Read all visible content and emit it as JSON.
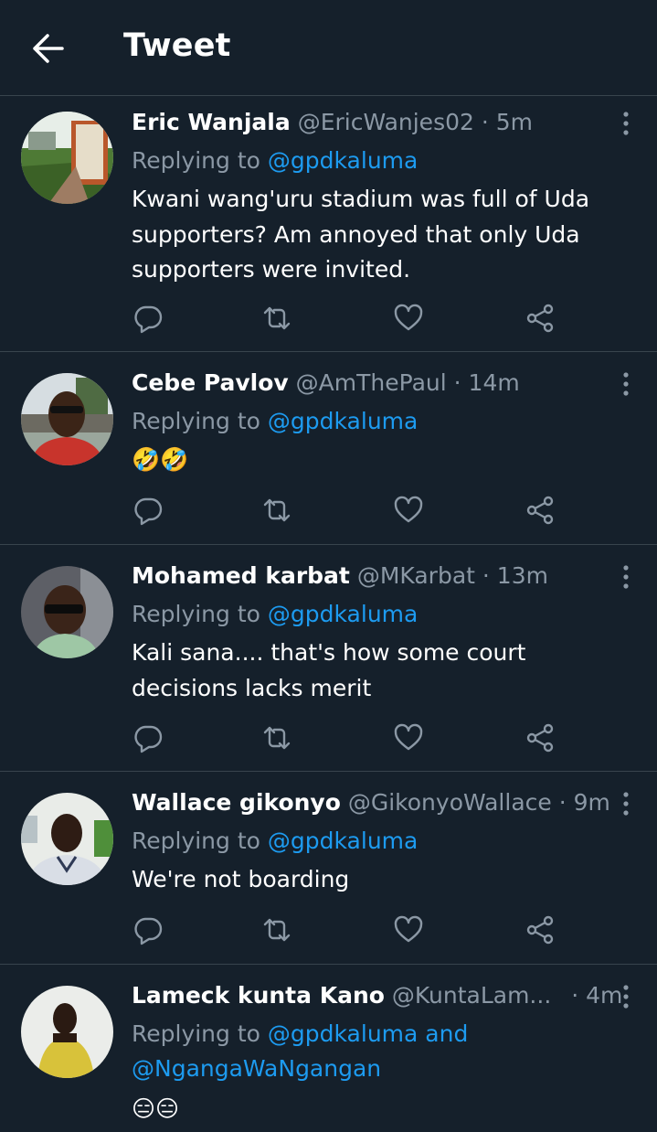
{
  "header": {
    "title": "Tweet"
  },
  "tweets": [
    {
      "name": "Eric Wanjala",
      "handle": "@EricWanjes02",
      "time": "· 5m",
      "replying_prefix": "Replying to",
      "replying_to": "@gpdkaluma",
      "text": "Kwani wang'uru stadium was full of Uda supporters? Am annoyed that only Uda supporters were invited."
    },
    {
      "name": "Cebe Pavlov",
      "handle": "@AmThePaul",
      "time": "· 14m",
      "replying_prefix": "Replying to",
      "replying_to": "@gpdkaluma",
      "text": "🤣🤣"
    },
    {
      "name": "Mohamed karbat",
      "handle": "@MKarbat",
      "time": "· 13m",
      "replying_prefix": "Replying to",
      "replying_to": "@gpdkaluma",
      "text": "Kali sana.... that's how some court decisions lacks merit"
    },
    {
      "name": "Wallace gikonyo",
      "handle": "@GikonyoWallace",
      "time": "· 9m",
      "replying_prefix": "Replying to",
      "replying_to": "@gpdkaluma",
      "text": "We're not boarding"
    },
    {
      "name": "Lameck kunta Kano",
      "handle": "@KuntaLam...",
      "time": "· 4m",
      "replying_prefix": "Replying to",
      "replying_to": "@gpdkaluma and @NgangaWaNgangan",
      "text": "😑😑"
    }
  ],
  "icons": {
    "back": "arrow-left-icon",
    "more": "more-vertical-icon",
    "reply": "reply-bubble-icon",
    "retweet": "retweet-icon",
    "like": "heart-icon",
    "share": "share-icon"
  },
  "colors": {
    "background": "#15202b",
    "divider": "#38444d",
    "secondary_text": "#8b98a5",
    "link": "#1d9bf0"
  }
}
